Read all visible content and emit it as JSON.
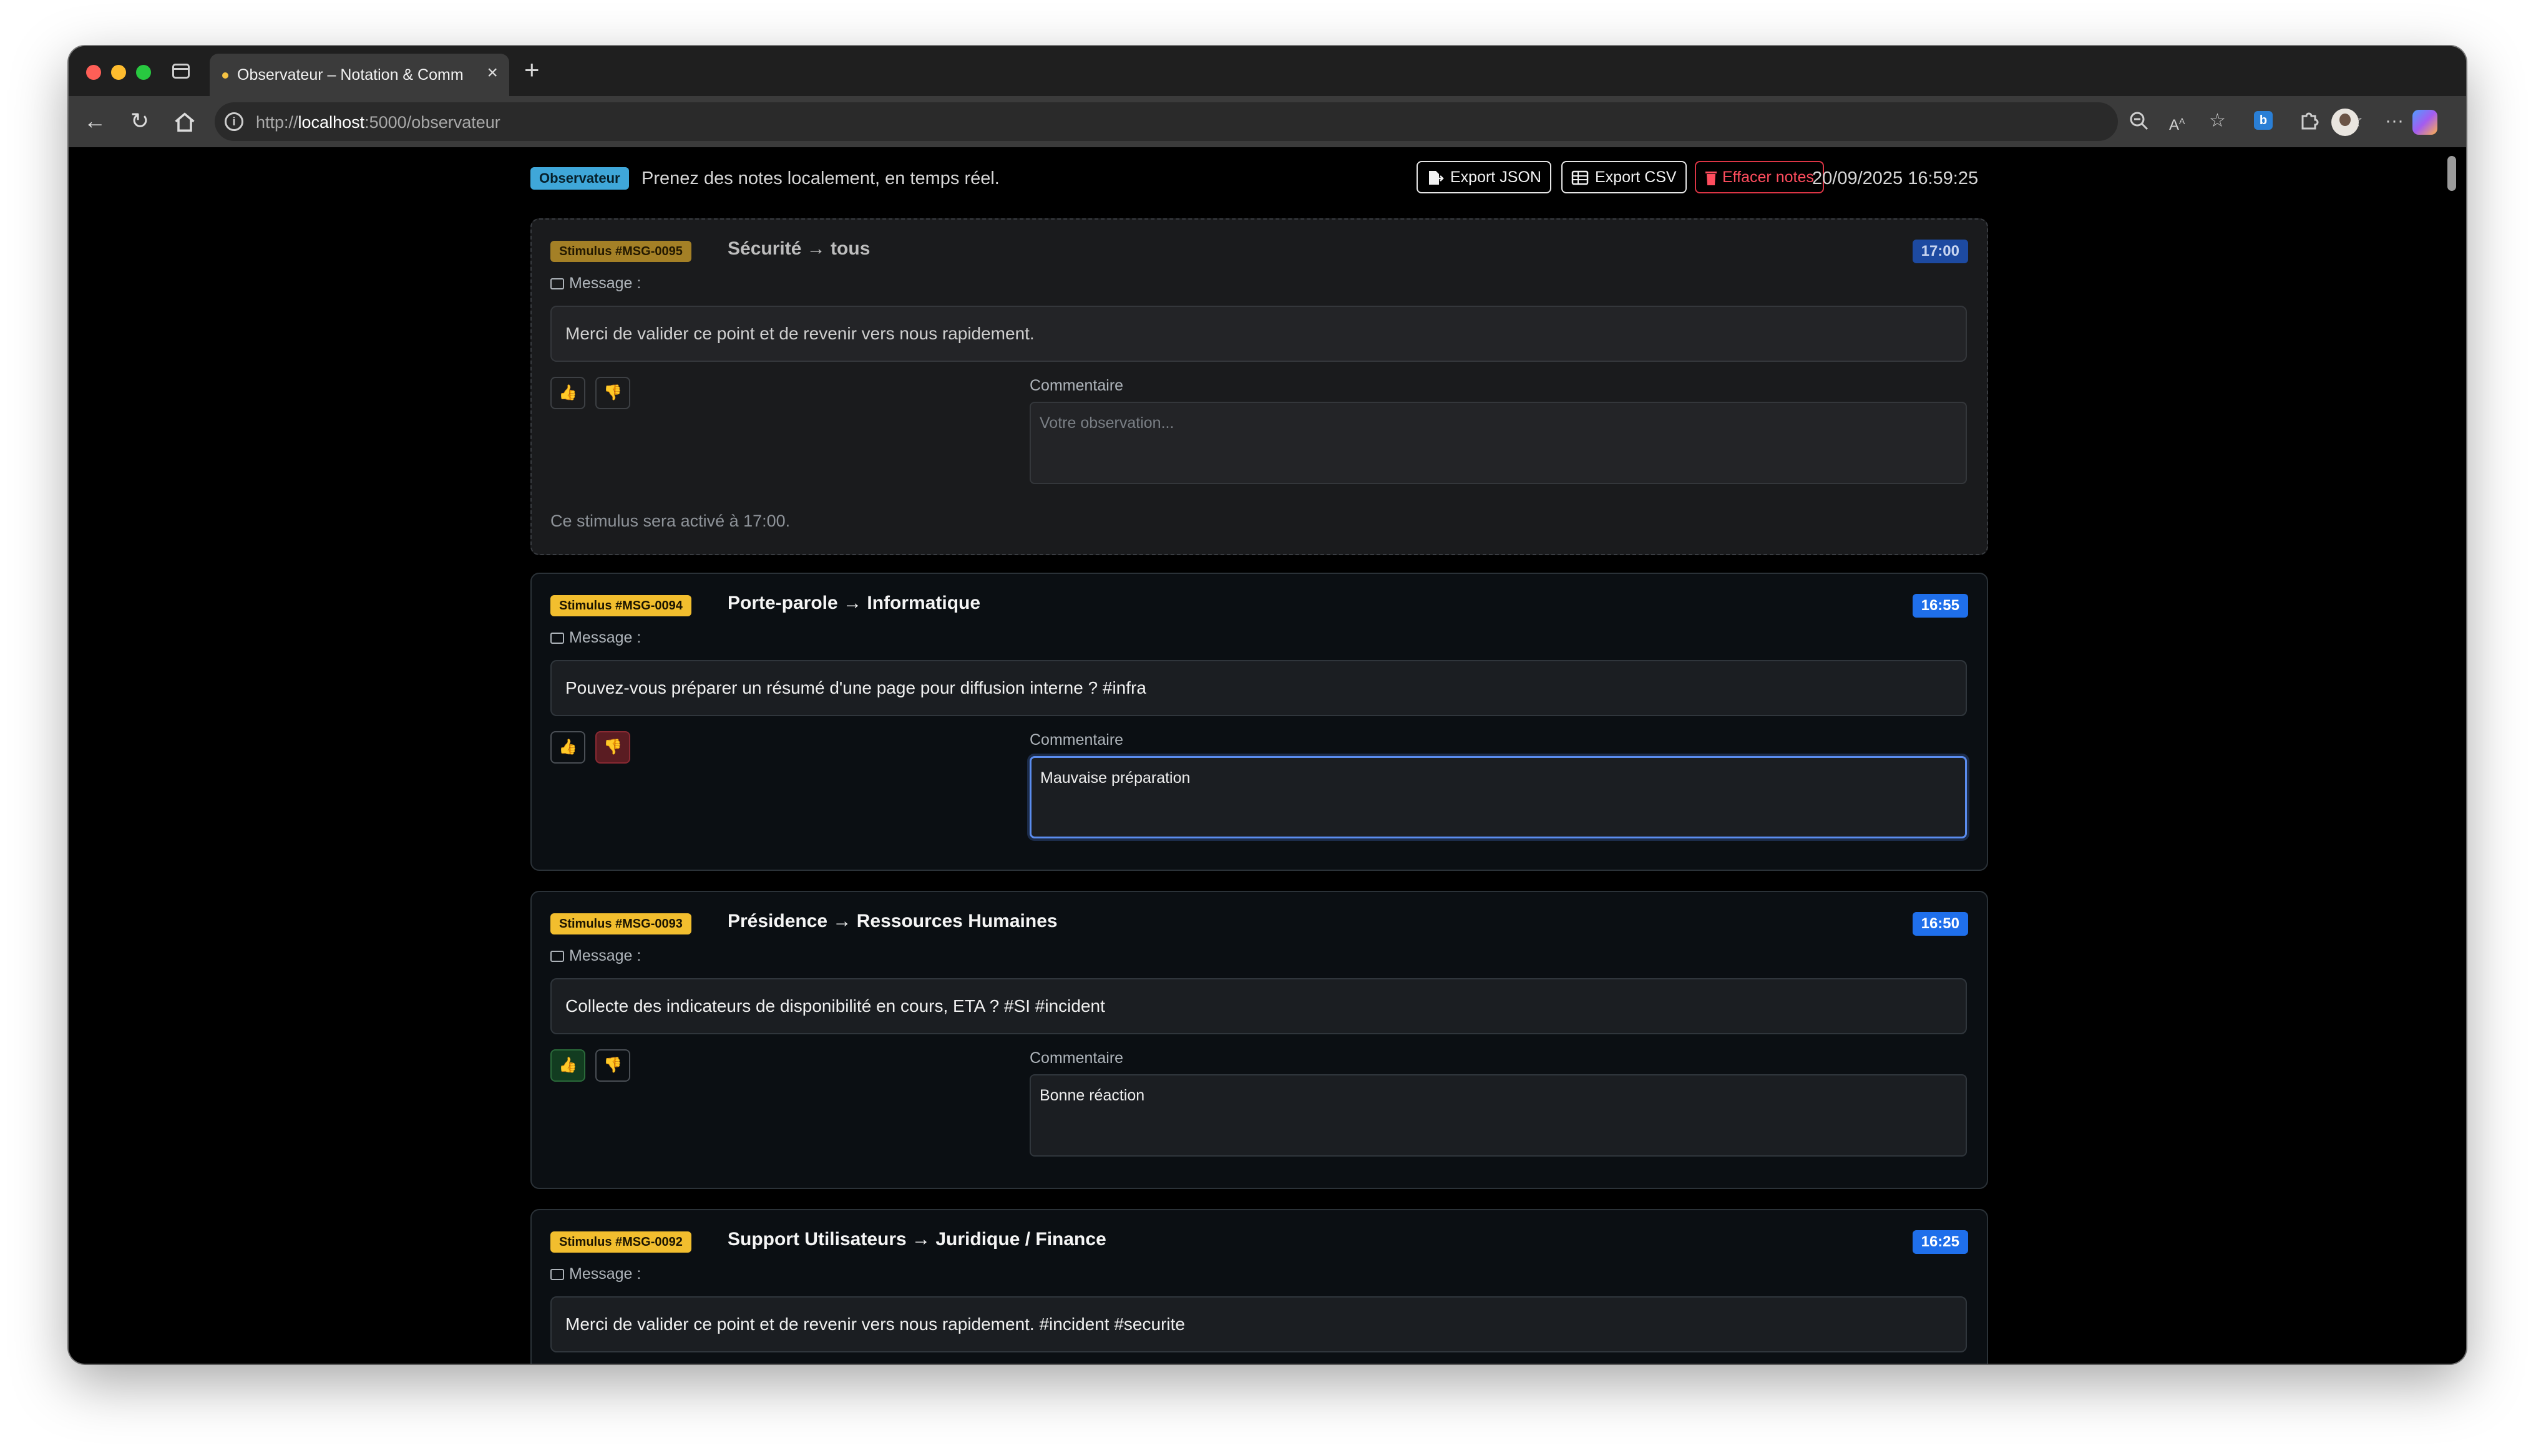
{
  "browser": {
    "tab_title": "Observateur – Notation & Comm",
    "new_tab_label": "+",
    "url_prefix": "http://",
    "url_host": "localhost",
    "url_path": ":5000/observateur",
    "icons": [
      "back-icon",
      "reload-icon",
      "home-icon",
      "info-icon",
      "zoom-icon",
      "read-aloud-icon",
      "favorite-star-icon",
      "extension-icon",
      "puzzle-icon",
      "favorites-icon",
      "profile-avatar",
      "more-icon",
      "copilot-icon"
    ]
  },
  "header": {
    "role_badge": "Observateur",
    "subtitle": "Prenez des notes localement, en temps réel.",
    "export_json_label": "Export JSON",
    "export_csv_label": "Export CSV",
    "clear_label": "Effacer notes",
    "datetime": "20/09/2025 16:59:25"
  },
  "message_label": "Message :",
  "comment_label": "Commentaire",
  "stimuli": [
    {
      "badge": "Stimulus #MSG-0095",
      "title": "Sécurité → tous",
      "time": "17:00",
      "message": "Merci de valider ce point et de revenir vers nous rapidement.",
      "comment_placeholder": "Votre observation...",
      "comment": "",
      "note": "Ce stimulus sera activé à 17:00.",
      "vote": "none"
    },
    {
      "badge": "Stimulus #MSG-0094",
      "title": "Porte-parole → Informatique",
      "time": "16:55",
      "message": "Pouvez-vous préparer un résumé d'une page pour diffusion interne ? #infra",
      "comment": "Mauvaise préparation",
      "vote": "down"
    },
    {
      "badge": "Stimulus #MSG-0093",
      "title": "Présidence → Ressources Humaines",
      "time": "16:50",
      "message": "Collecte des indicateurs de disponibilité en cours, ETA ? #SI #incident",
      "comment": "Bonne réaction",
      "vote": "up"
    },
    {
      "badge": "Stimulus #MSG-0092",
      "title": "Support Utilisateurs → Juridique / Finance",
      "time": "16:25",
      "message": "Merci de valider ce point et de revenir vers nous rapidement. #incident #securite"
    }
  ],
  "colors": {
    "accent_blue": "#1f6feb",
    "stimulus_yellow": "#f2be2e",
    "danger_red": "#dc3545",
    "observer_badge": "#3fa7d9"
  }
}
